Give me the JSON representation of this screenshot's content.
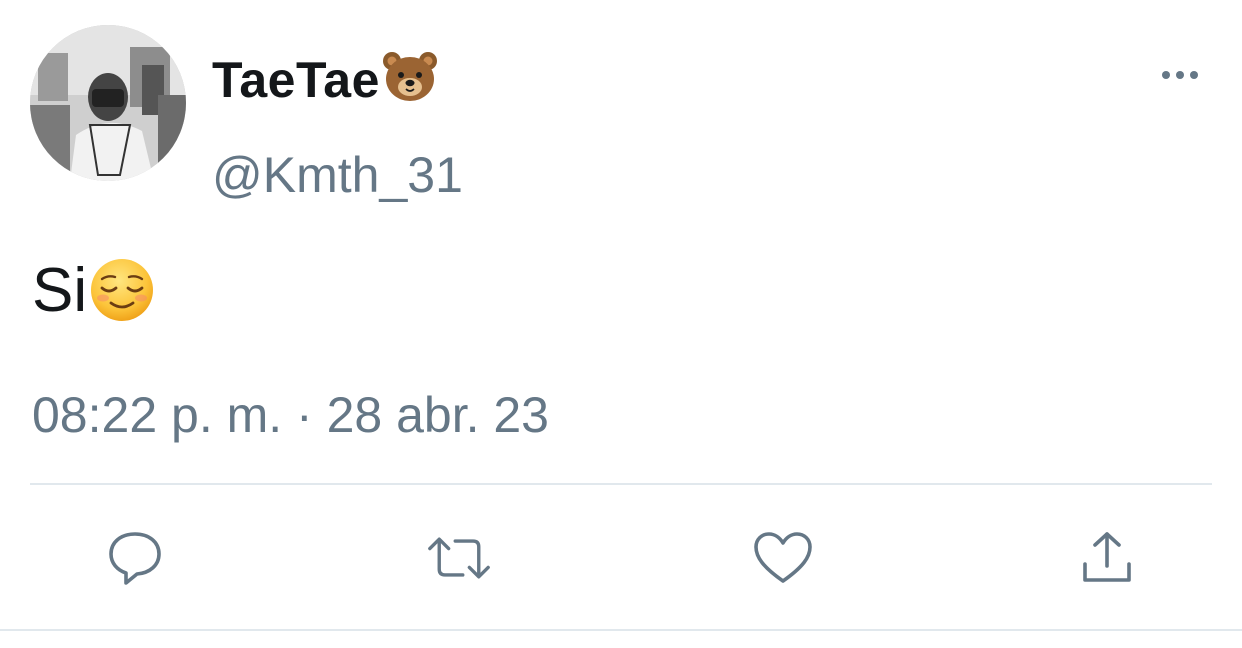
{
  "tweet": {
    "author": {
      "display_name": "TaeTae",
      "name_emoji_icon": "bear-face-icon",
      "handle": "@Kmth_31",
      "avatar": "avatar-photo"
    },
    "text": "Si",
    "text_emoji_icon": "relieved-face-icon",
    "timestamp": "08:22 p. m. · 28 abr. 23",
    "more_icon": "more-horizontal-icon",
    "actions": [
      {
        "name": "reply",
        "icon": "reply-icon"
      },
      {
        "name": "retweet",
        "icon": "retweet-icon"
      },
      {
        "name": "like",
        "icon": "heart-icon"
      },
      {
        "name": "share",
        "icon": "share-icon"
      }
    ]
  },
  "colors": {
    "text_primary": "#14171a",
    "text_secondary": "#657786",
    "icon": "#657786",
    "divider": "#e1e8ed"
  }
}
